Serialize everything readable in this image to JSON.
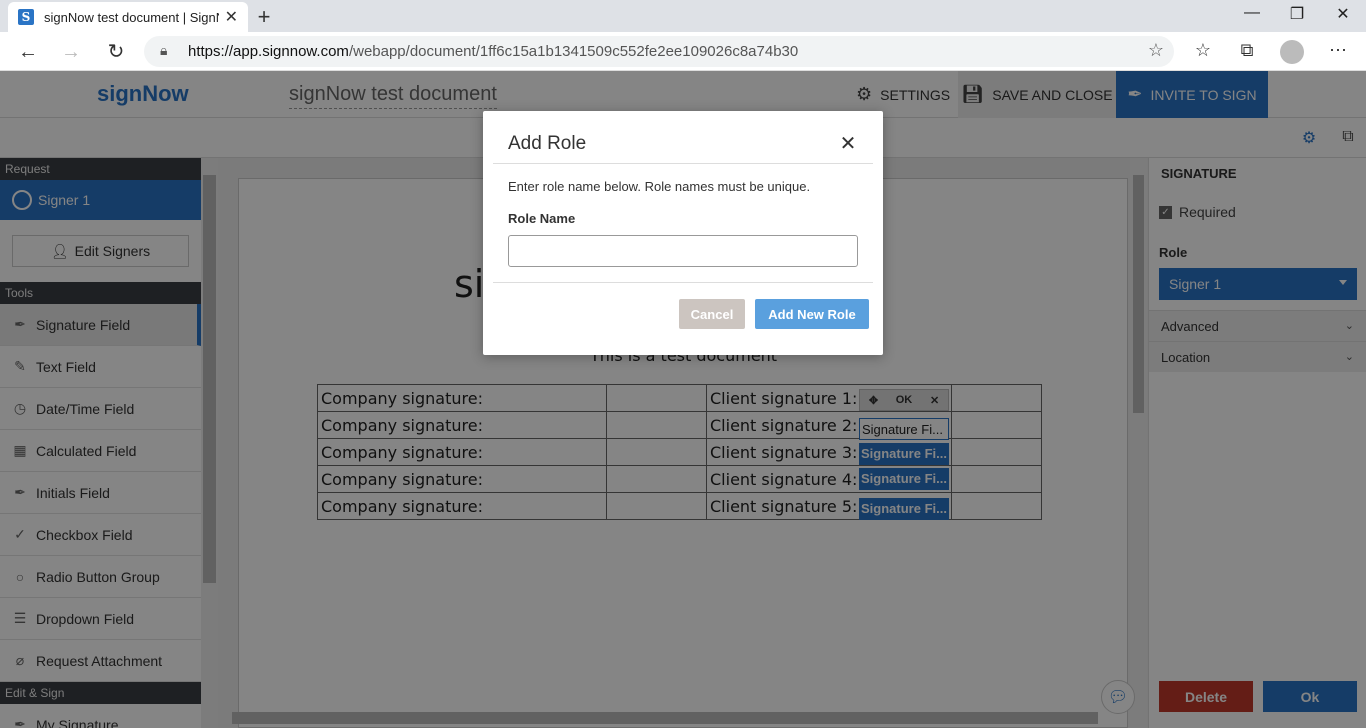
{
  "browser": {
    "tab_title": "signNow test document | SignNo",
    "favicon_letter": "S",
    "url_host": "https://app.signnow.com",
    "url_path": "/webapp/document/1ff6c15a1b1341509c552fe2ee109026c8a74b30"
  },
  "header": {
    "logo": "signNow",
    "document_title": "signNow test document",
    "settings_label": "SETTINGS",
    "save_close_label": "SAVE AND CLOSE",
    "invite_label": "INVITE TO SIGN"
  },
  "sidebar": {
    "request_section": "Request",
    "signer": "Signer 1",
    "edit_signers": "Edit Signers",
    "tools_section": "Tools",
    "tools": [
      {
        "label": "Signature Field",
        "icon": "pen-icon"
      },
      {
        "label": "Text Field",
        "icon": "pencil-icon"
      },
      {
        "label": "Date/Time Field",
        "icon": "clock-icon"
      },
      {
        "label": "Calculated Field",
        "icon": "calculator-icon"
      },
      {
        "label": "Initials Field",
        "icon": "pen-icon"
      },
      {
        "label": "Checkbox Field",
        "icon": "check-icon"
      },
      {
        "label": "Radio Button Group",
        "icon": "radio-icon"
      },
      {
        "label": "Dropdown Field",
        "icon": "list-icon"
      },
      {
        "label": "Request Attachment",
        "icon": "paperclip-icon"
      }
    ],
    "edit_sign_section": "Edit & Sign",
    "my_signature": "My Signature"
  },
  "document": {
    "title_left": "si",
    "title_right": "nt",
    "subtitle": "This is a test document",
    "rows": [
      {
        "company": "Company signature:",
        "client": "Client signature 1:"
      },
      {
        "company": "Company signature:",
        "client": "Client signature 2:"
      },
      {
        "company": "Company signature:",
        "client": "Client signature 3:"
      },
      {
        "company": "Company signature:",
        "client": "Client signature 4:"
      },
      {
        "company": "Company signature:",
        "client": "Client signature 5:"
      }
    ],
    "signature_field_label": "Signature Fi...",
    "field_toolbar_ok": "OK"
  },
  "right_panel": {
    "title": "SIGNATURE",
    "required_label": "Required",
    "required_checked": true,
    "role_label": "Role",
    "role_value": "Signer 1",
    "advanced_label": "Advanced",
    "location_label": "Location",
    "delete_label": "Delete",
    "ok_label": "Ok"
  },
  "modal": {
    "title": "Add Role",
    "description": "Enter role name below. Role names must be unique.",
    "field_label": "Role Name",
    "field_value": "",
    "cancel_label": "Cancel",
    "add_label": "Add New Role"
  },
  "colors": {
    "brand": "#2a74c5",
    "delete": "#c0392b",
    "overlay": "rgba(0,0,0,0.48)"
  }
}
